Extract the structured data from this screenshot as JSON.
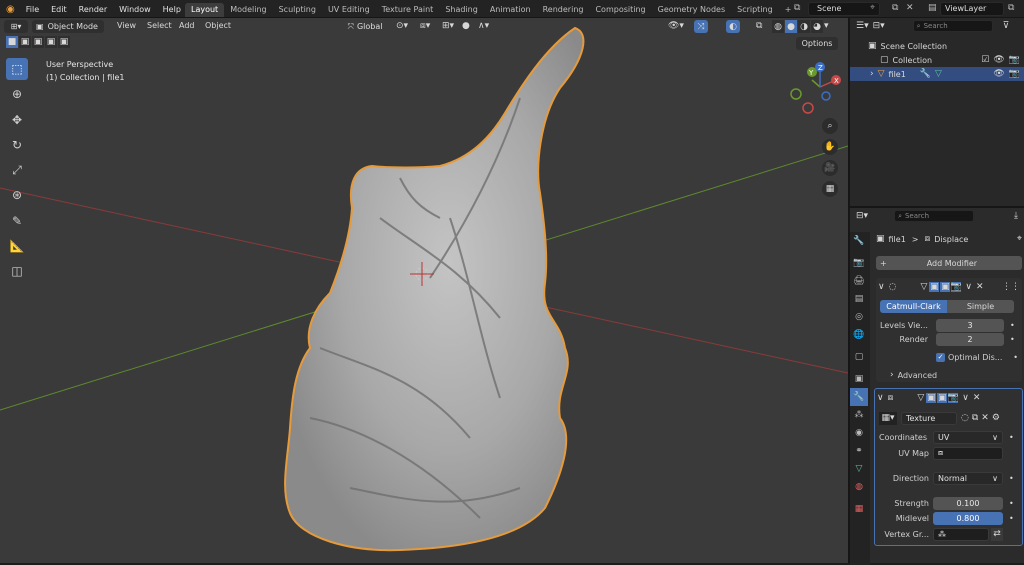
{
  "menu": [
    "File",
    "Edit",
    "Render",
    "Window",
    "Help"
  ],
  "workspaces": [
    "Layout",
    "Modeling",
    "Sculpting",
    "UV Editing",
    "Texture Paint",
    "Shading",
    "Animation",
    "Rendering",
    "Compositing",
    "Geometry Nodes",
    "Scripting"
  ],
  "active_workspace": "Layout",
  "add_workspace": "+",
  "scene_name": "Scene",
  "view_layer": "ViewLayer",
  "viewport": {
    "mode": "Object Mode",
    "header_menus": [
      "View",
      "Select",
      "Add",
      "Object"
    ],
    "transform_orientation": "Global",
    "options_label": "Options",
    "perspective_label": "User Perspective",
    "collection_label": "(1) Collection | file1",
    "gizmo_axes": [
      "X",
      "Y",
      "Z"
    ]
  },
  "outliner": {
    "search_placeholder": "Search",
    "items": [
      {
        "label": "Scene Collection"
      },
      {
        "label": "Collection"
      },
      {
        "label": "file1"
      }
    ]
  },
  "properties": {
    "search_placeholder": "Search",
    "object_name": "file1",
    "breadcrumb_sep": ">",
    "modifier_name": "Displace",
    "add_modifier": "Add Modifier",
    "subdiv": {
      "tab_catmull": "Catmull-Clark",
      "tab_simple": "Simple",
      "levels_label": "Levels Vie...",
      "levels_value": "3",
      "render_label": "Render",
      "render_value": "2",
      "optimal_label": "Optimal Dis...",
      "advanced_label": "Advanced"
    },
    "displace": {
      "texture_name": "Texture",
      "coordinates_label": "Coordinates",
      "coordinates_value": "UV",
      "uvmap_label": "UV Map",
      "direction_label": "Direction",
      "direction_value": "Normal",
      "strength_label": "Strength",
      "strength_value": "0.100",
      "midlevel_label": "Midlevel",
      "midlevel_value": "0.800",
      "vertex_group_label": "Vertex Gr..."
    }
  }
}
